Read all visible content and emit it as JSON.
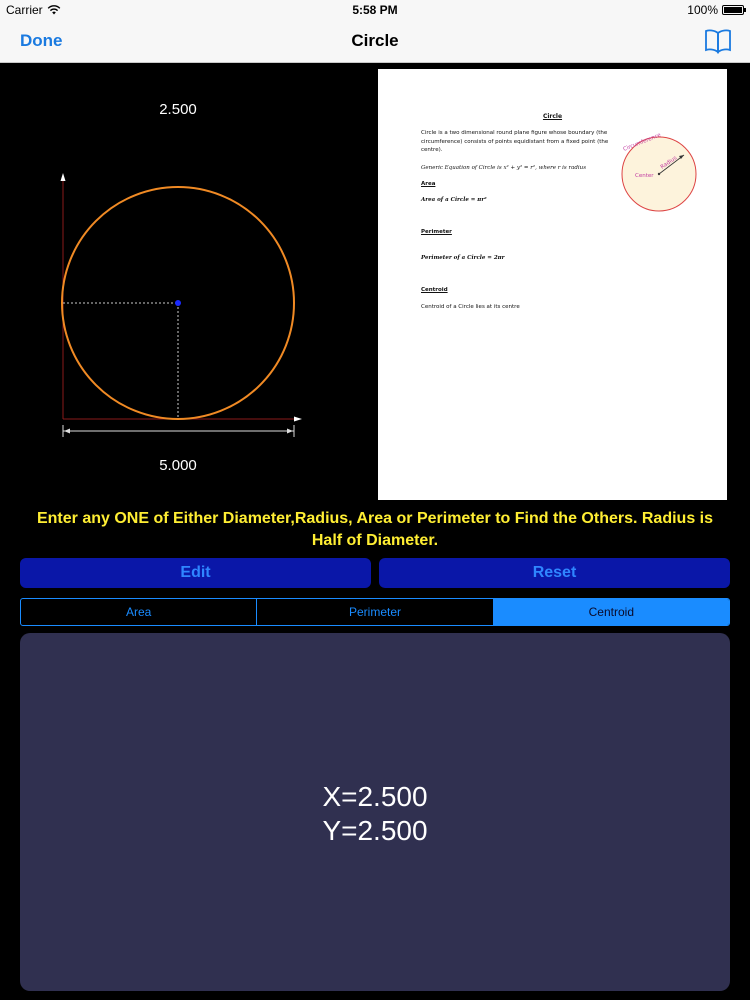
{
  "status_bar": {
    "carrier": "Carrier",
    "time": "5:58 PM",
    "battery": "100%"
  },
  "nav": {
    "done_label": "Done",
    "title": "Circle",
    "book_icon": "book-icon"
  },
  "drawing": {
    "top_dimension": "2.500",
    "bottom_dimension": "5.000"
  },
  "sheet": {
    "title": "Circle",
    "definition": "Circle is a two dimensional round plane figure whose boundary (the circumference) consists of points equidistant from a fixed point (the centre).",
    "generic_equation": "Generic Equation of Circle is x² + y² = r², where r is radius",
    "area_heading": "Area",
    "area_formula": "Area of a Circle = πr²",
    "perimeter_heading": "Perimeter",
    "perimeter_formula": "Perimeter of a Circle = 2πr",
    "centroid_heading": "Centroid",
    "centroid_text": "Centroid of a Circle lies at its centre",
    "figure_labels": {
      "circumference": "Circumference",
      "radius": "Radius",
      "center": "Center"
    }
  },
  "instruction": "Enter any ONE of Either Diameter,Radius, Area or Perimeter to Find the Others. Radius is Half of Diameter.",
  "buttons": {
    "edit": "Edit",
    "reset": "Reset"
  },
  "tabs": [
    {
      "label": "Area",
      "active": false
    },
    {
      "label": "Perimeter",
      "active": false
    },
    {
      "label": "Centroid",
      "active": true
    }
  ],
  "result": {
    "x": "X=2.500",
    "y": "Y=2.500"
  },
  "colors": {
    "accent": "#1a8cff",
    "instruction": "#ffee33",
    "circle": "#f08a24",
    "panel": "#303050",
    "button": "#0a17a8"
  }
}
